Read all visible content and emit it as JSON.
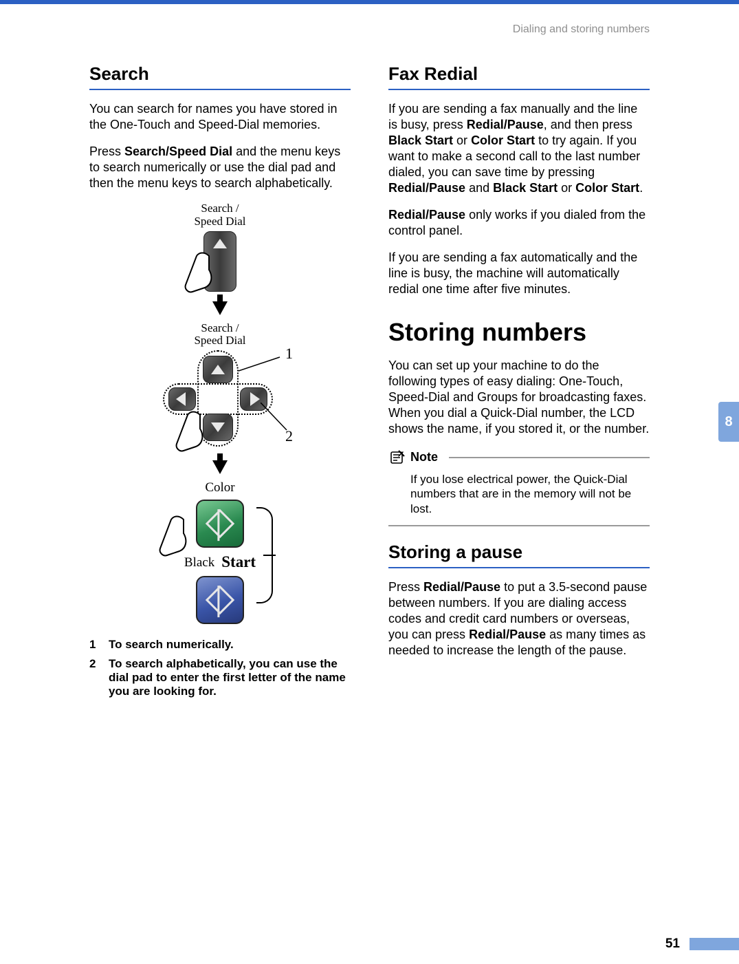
{
  "header": {
    "breadcrumb": "Dialing and storing numbers"
  },
  "sideTab": {
    "label": "8"
  },
  "footer": {
    "page": "51"
  },
  "left": {
    "h_search": "Search",
    "p1": "You can search for names you have stored in the One-Touch and Speed-Dial memories.",
    "p2_a": "Press ",
    "p2_b": "Search/Speed Dial",
    "p2_c": " and the menu keys to search numerically or use the dial pad and then the menu keys to search alphabetically.",
    "fig": {
      "label1": "Search /\nSpeed Dial",
      "label2": "Search /\nSpeed Dial",
      "callout1": "1",
      "callout2": "2",
      "color": "Color",
      "black": "Black",
      "start": "Start"
    },
    "list": {
      "n1": "1",
      "t1": "To search numerically.",
      "n2": "2",
      "t2": "To search alphabetically, you can use the dial pad to enter the first letter of the name you are looking for."
    }
  },
  "right": {
    "h_fax": "Fax Redial",
    "p1_a": "If you are sending a fax manually and the line is busy, press ",
    "p1_b": "Redial/Pause",
    "p1_c": ", and then press ",
    "p1_d": "Black Start",
    "p1_e": " or ",
    "p1_f": "Color Start",
    "p1_g": " to try again. If you want to make a second call to the last number dialed, you can save time by pressing ",
    "p1_h": "Redial/Pause",
    "p1_i": " and ",
    "p1_j": "Black Start",
    "p1_k": " or ",
    "p1_l": "Color Start",
    "p1_m": ".",
    "p2_a": "Redial/Pause",
    "p2_b": " only works if you dialed from the control panel.",
    "p3": "If you are sending a fax automatically and the line is busy, the machine will automatically redial one time after five minutes.",
    "h_storing": "Storing numbers",
    "p4": "You can set up your machine to do the following types of easy dialing: One-Touch, Speed-Dial and Groups for broadcasting faxes. When you dial a Quick-Dial number, the LCD shows the name, if you stored it, or the number.",
    "note_label": "Note",
    "note_body": "If you lose electrical power, the Quick-Dial numbers that are in the memory will not be lost.",
    "h_pause": "Storing a pause",
    "p5_a": "Press ",
    "p5_b": "Redial/Pause",
    "p5_c": " to put a 3.5-second pause between numbers. If you are dialing access codes and credit card numbers or overseas, you can press ",
    "p5_d": "Redial/Pause",
    "p5_e": " as many times as needed to increase the length of the pause."
  }
}
